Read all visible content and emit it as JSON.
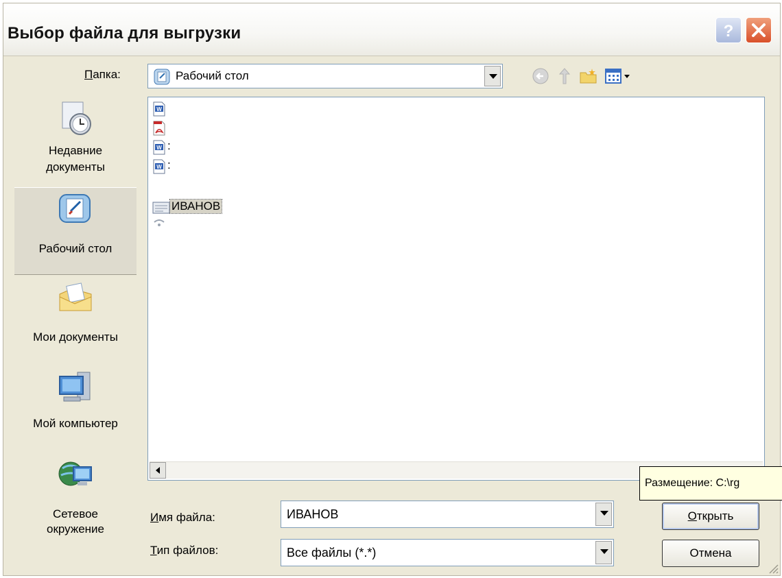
{
  "window": {
    "title": "Выбор файла для выгрузки"
  },
  "lookin": {
    "label": "Папка:",
    "label_access_key": "П",
    "label_rest": "апка:",
    "value": "Рабочий стол"
  },
  "places": [
    {
      "label": "Недавние документы",
      "line1": "Недавние",
      "line2": "документы",
      "icon": "recent-documents-icon"
    },
    {
      "label": "Рабочий стол",
      "line1": "Рабочий стол",
      "line2": "",
      "icon": "desktop-icon",
      "selected": true
    },
    {
      "label": "Мои документы",
      "line1": "Мои документы",
      "line2": "",
      "icon": "my-documents-icon"
    },
    {
      "label": "Мой компьютер",
      "line1": "Мой компьютер",
      "line2": "",
      "icon": "my-computer-icon"
    },
    {
      "label": "Сетевое окружение",
      "line1": "Сетевое",
      "line2": "окружение",
      "icon": "network-icon"
    }
  ],
  "files": [
    {
      "name": "",
      "icon": "word-document-icon"
    },
    {
      "name": "",
      "icon": "pdf-document-icon"
    },
    {
      "name": ":",
      "icon": "word-document-icon"
    },
    {
      "name": ":",
      "icon": "word-document-icon"
    },
    {
      "name": "ИВАНОВ",
      "icon": "text-file-icon",
      "selected": true
    },
    {
      "name": "",
      "icon": "shortcut-icon"
    }
  ],
  "tooltip": {
    "text": "Размещение: C:\\rg"
  },
  "filename": {
    "label": "Имя файла:",
    "label_access_key": "И",
    "label_rest": "мя файла:",
    "value": "ИВАНОВ"
  },
  "filetype": {
    "label": "Тип файлов:",
    "label_access_key": "Т",
    "label_rest": "ип файлов:",
    "value": "Все файлы (*.*)"
  },
  "buttons": {
    "open": "Открыть",
    "open_access_key": "О",
    "open_rest": "ткрыть",
    "cancel": "Отмена"
  },
  "colors": {
    "dialog_bg": "#ece9d8",
    "close_button": "#d9502a",
    "help_button": "#a9b9dc",
    "field_border": "#7f9db9",
    "tooltip_bg": "#ffffe1"
  }
}
